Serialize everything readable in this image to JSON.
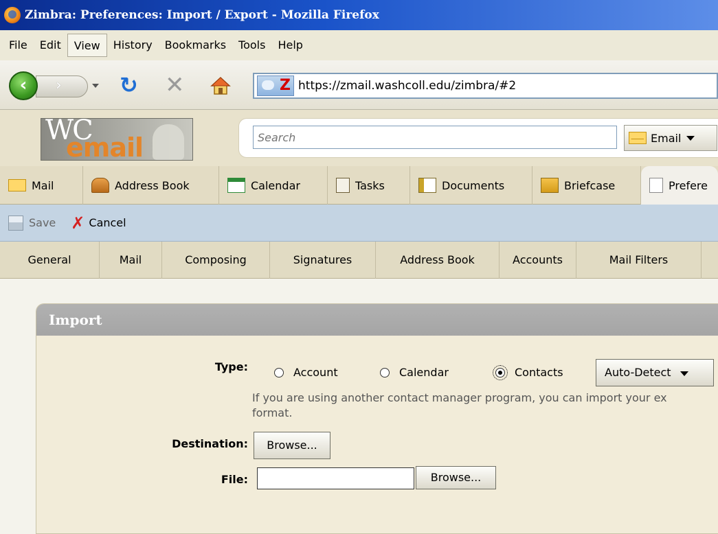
{
  "window": {
    "title": "Zimbra: Preferences: Import / Export - Mozilla Firefox"
  },
  "menubar": {
    "items": [
      "File",
      "Edit",
      "View",
      "History",
      "Bookmarks",
      "Tools",
      "Help"
    ],
    "active": "View"
  },
  "navbar": {
    "url": "https://zmail.washcoll.edu/zimbra/#2"
  },
  "header": {
    "logo": {
      "line1": "WC",
      "line2": "email"
    },
    "search": {
      "placeholder": "Search"
    },
    "search_type": "Email"
  },
  "app_tabs": [
    "Mail",
    "Address Book",
    "Calendar",
    "Tasks",
    "Documents",
    "Briefcase",
    "Prefere"
  ],
  "toolbar": {
    "save_label": "Save",
    "cancel_label": "Cancel"
  },
  "pref_tabs": [
    "General",
    "Mail",
    "Composing",
    "Signatures",
    "Address Book",
    "Accounts",
    "Mail Filters"
  ],
  "import": {
    "title": "Import",
    "type_label": "Type:",
    "options": [
      "Account",
      "Calendar",
      "Contacts"
    ],
    "selected": "Contacts",
    "format": "Auto-Detect",
    "help_line1": "If you are using another contact manager program, you can import your ex",
    "help_line2": "format.",
    "destination_label": "Destination:",
    "destination_button": "Browse...",
    "file_label": "File:",
    "file_value": "",
    "file_button": "Browse..."
  },
  "colors": {
    "title_bar": "#1a53c9",
    "toolbar": "#c4d4e3",
    "panel_header": "#a9a9a9",
    "brand_orange": "#e3852a"
  }
}
